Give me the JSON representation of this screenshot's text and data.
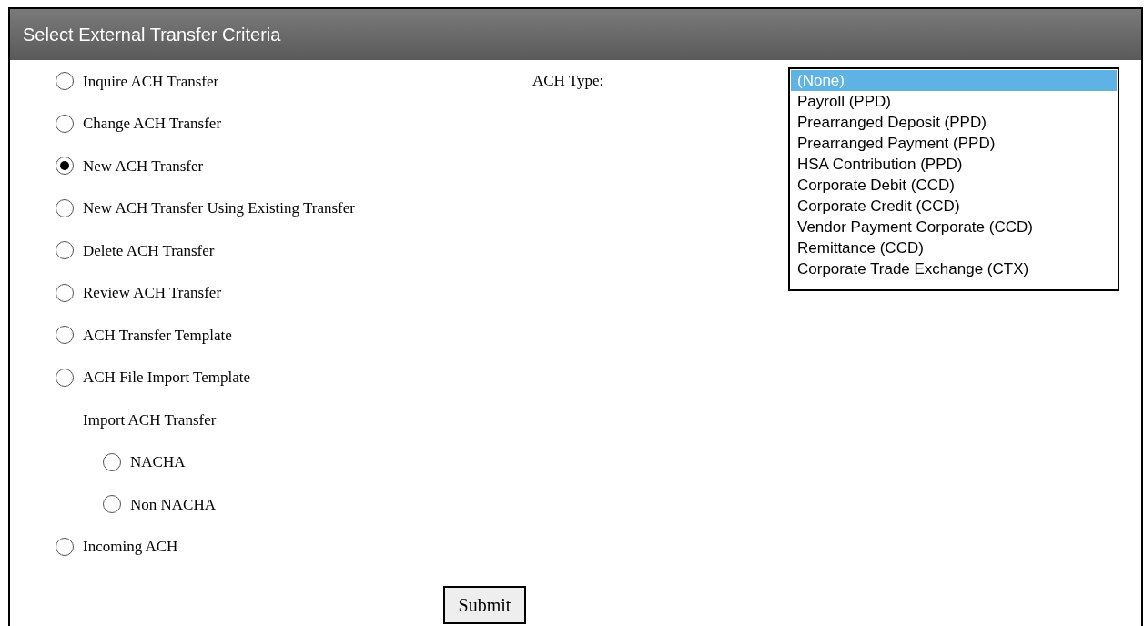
{
  "header": {
    "title": "Select External Transfer Criteria"
  },
  "options": [
    {
      "kind": "radio",
      "label": "Inquire ACH Transfer",
      "selected": false
    },
    {
      "kind": "radio",
      "label": "Change ACH Transfer",
      "selected": false
    },
    {
      "kind": "radio",
      "label": "New ACH Transfer",
      "selected": true
    },
    {
      "kind": "radio",
      "label": "New ACH Transfer Using Existing Transfer",
      "selected": false
    },
    {
      "kind": "radio",
      "label": "Delete ACH Transfer",
      "selected": false
    },
    {
      "kind": "radio",
      "label": "Review ACH Transfer",
      "selected": false
    },
    {
      "kind": "radio",
      "label": "ACH Transfer Template",
      "selected": false
    },
    {
      "kind": "radio",
      "label": "ACH File Import Template",
      "selected": false
    },
    {
      "kind": "group",
      "label": "Import ACH Transfer",
      "children": [
        {
          "kind": "radio",
          "label": "NACHA",
          "selected": false
        },
        {
          "kind": "radio",
          "label": "Non NACHA",
          "selected": false
        }
      ]
    },
    {
      "kind": "radio",
      "label": "Incoming ACH",
      "selected": false
    }
  ],
  "ach_type": {
    "label": "ACH Type:",
    "items": [
      {
        "label": "(None)",
        "selected": true
      },
      {
        "label": "Payroll (PPD)",
        "selected": false
      },
      {
        "label": "Prearranged Deposit (PPD)",
        "selected": false
      },
      {
        "label": "Prearranged Payment (PPD)",
        "selected": false
      },
      {
        "label": "HSA Contribution (PPD)",
        "selected": false
      },
      {
        "label": "Corporate Debit (CCD)",
        "selected": false
      },
      {
        "label": "Corporate Credit (CCD)",
        "selected": false
      },
      {
        "label": "Vendor Payment Corporate (CCD)",
        "selected": false
      },
      {
        "label": "Remittance (CCD)",
        "selected": false
      },
      {
        "label": "Corporate Trade Exchange (CTX)",
        "selected": false
      }
    ]
  },
  "submit": {
    "label": "Submit"
  }
}
